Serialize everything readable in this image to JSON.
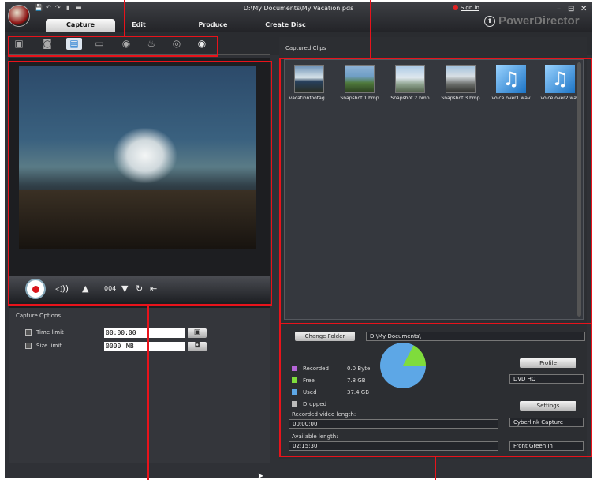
{
  "titlebar": {
    "file_path": "D:\\My Documents\\My Vacation.pds",
    "sign_in": "Sign in",
    "brand": "PowerDirector",
    "quick_access": [
      "💾",
      "↶",
      "↷",
      "▮",
      "▬"
    ],
    "win_min": "–",
    "win_max": "⊟",
    "win_close": "✕"
  },
  "tabs": [
    "Capture",
    "Edit",
    "Produce",
    "Create Disc"
  ],
  "toolbar": {
    "icons": [
      "camcorder-icon",
      "dv-camera-icon",
      "tv-icon",
      "digital-tv-icon",
      "webcam-icon",
      "microphone-icon",
      "cd-audio-icon",
      "dvd-icon"
    ]
  },
  "player": {
    "frame": "004"
  },
  "capture_options": {
    "header": "Capture Options",
    "time_limit_label": "Time limit",
    "time_limit_value": "00:00:00",
    "size_limit_label": "Size limit",
    "size_limit_value": "0000",
    "size_unit": "MB"
  },
  "captured": {
    "label": "Captured Clips",
    "clips": [
      {
        "name": "vacationfootag...",
        "type": "video"
      },
      {
        "name": "Snapshot 1.bmp",
        "type": "image"
      },
      {
        "name": "Snapshot 2.bmp",
        "type": "image"
      },
      {
        "name": "Snapshot 3.bmp",
        "type": "image"
      },
      {
        "name": "voice over1.wav",
        "type": "audio"
      },
      {
        "name": "voice over2.wav",
        "type": "audio"
      }
    ]
  },
  "storage": {
    "change_folder": "Change Folder",
    "folder": "D:\\My Documents\\",
    "legend": [
      {
        "label": "Recorded",
        "value": "0.0 Byte",
        "color": "#b565d8"
      },
      {
        "label": "Free",
        "value": "7.8 GB",
        "color": "#7fdc3c"
      },
      {
        "label": "Used",
        "value": "37.4 GB",
        "color": "#5da7e6"
      },
      {
        "label": "Dropped",
        "value": "",
        "color": "#bbbbbb"
      }
    ],
    "used_fraction": 0.827,
    "recorded_length_label": "Recorded video length:",
    "recorded_length": "00:00:00",
    "available_length_label": "Available length:",
    "available_length": "02:15:30",
    "profile_button": "Profile",
    "profile_value": "DVD HQ",
    "settings_button": "Settings",
    "capture_device": "Cyberlink Capture",
    "input_source": "Front Green In"
  }
}
